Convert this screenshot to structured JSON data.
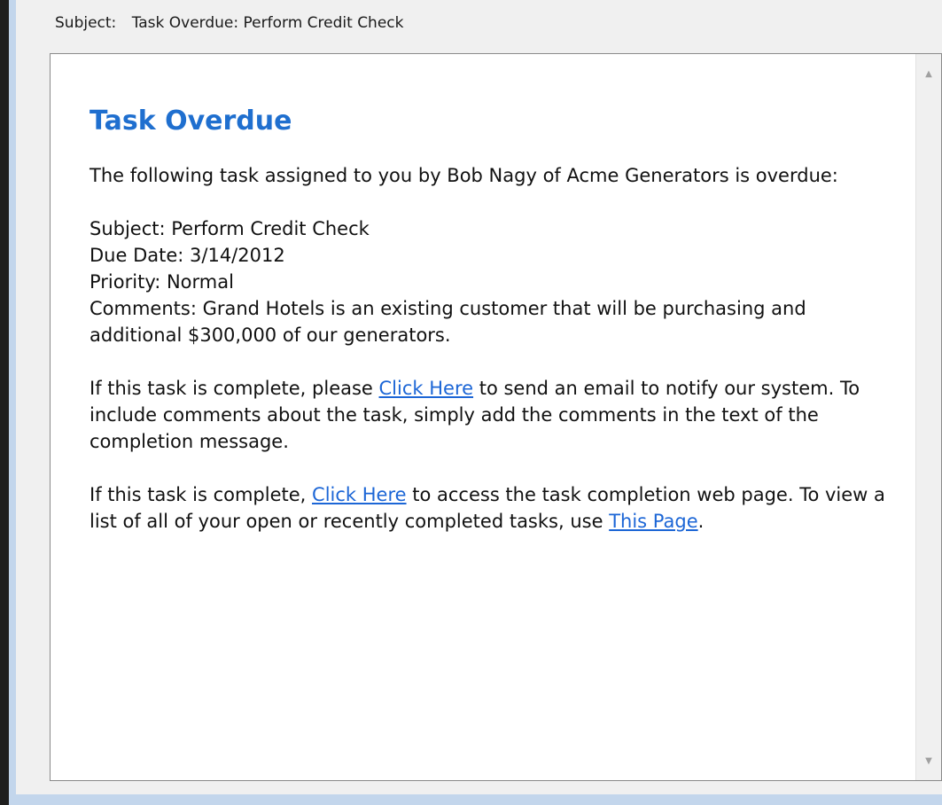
{
  "header": {
    "subject_label": "Subject:",
    "subject_value": "Task Overdue: Perform Credit Check"
  },
  "message": {
    "title": "Task Overdue",
    "intro": "The following task assigned to you by Bob Nagy of Acme Generators is overdue:",
    "details": {
      "subject": "Subject: Perform Credit Check",
      "due_date": "Due Date: 3/14/2012",
      "priority": "Priority: Normal",
      "comments": "Comments: Grand Hotels is an existing customer that will be purchasing and additional $300,000 of our generators."
    },
    "para_email": {
      "before": "If this task is complete, please ",
      "link": "Click Here",
      "after": " to send an email to notify our system. To include comments about the task, simply add the comments in the text of the completion message."
    },
    "para_web": {
      "before": "If this task is complete, ",
      "link": "Click Here",
      "middle": " to access the task completion web page. To view a list of all of your open or recently completed tasks, use ",
      "link2": "This Page",
      "after": "."
    }
  },
  "scrollbar": {
    "up_icon": "▲",
    "down_icon": "▼"
  },
  "colors": {
    "title": "#1f6fcf",
    "link": "#1c66d6",
    "frame": "#c3d6ec",
    "window": "#f0f0f0"
  }
}
